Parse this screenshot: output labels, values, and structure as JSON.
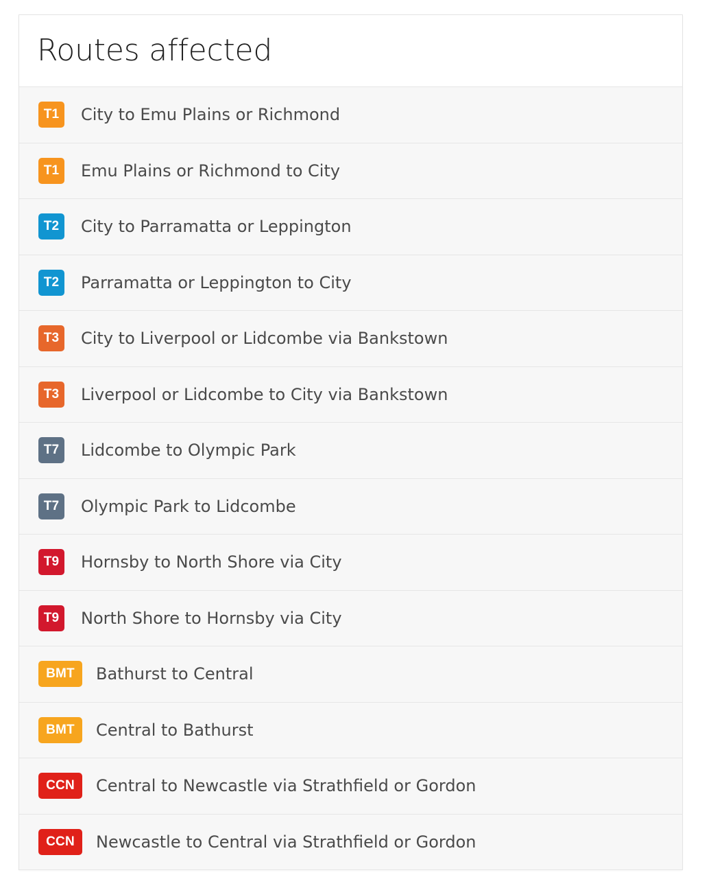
{
  "card": {
    "title": "Routes affected"
  },
  "colors": {
    "page_background": "#ffffff",
    "card_background": "#ffffff",
    "row_background": "#f7f7f7",
    "row_divider": "#e6e6e6",
    "card_border": "#e4e4e4",
    "title_text": "#202020",
    "label_text": "#4a4a4a",
    "badge_T1": "#f7941e",
    "badge_T2": "#1195d1",
    "badge_T3": "#e7672b",
    "badge_T7": "#5e7185",
    "badge_T9": "#d2182d",
    "badge_BMT": "#f7a51e",
    "badge_CCN": "#e02119"
  },
  "routes": [
    {
      "code": "T1",
      "label": "City to Emu Plains or Richmond",
      "color": "#f7941e",
      "wide": false
    },
    {
      "code": "T1",
      "label": "Emu Plains or Richmond to City",
      "color": "#f7941e",
      "wide": false
    },
    {
      "code": "T2",
      "label": "City to Parramatta or Leppington",
      "color": "#1195d1",
      "wide": false
    },
    {
      "code": "T2",
      "label": "Parramatta or Leppington to City",
      "color": "#1195d1",
      "wide": false
    },
    {
      "code": "T3",
      "label": "City to Liverpool or Lidcombe via Bankstown",
      "color": "#e7672b",
      "wide": false
    },
    {
      "code": "T3",
      "label": "Liverpool or Lidcombe to City via Bankstown",
      "color": "#e7672b",
      "wide": false
    },
    {
      "code": "T7",
      "label": "Lidcombe to Olympic Park",
      "color": "#5e7185",
      "wide": false
    },
    {
      "code": "T7",
      "label": "Olympic Park to Lidcombe",
      "color": "#5e7185",
      "wide": false
    },
    {
      "code": "T9",
      "label": "Hornsby to North Shore via City",
      "color": "#d2182d",
      "wide": false
    },
    {
      "code": "T9",
      "label": "North Shore to Hornsby via City",
      "color": "#d2182d",
      "wide": false
    },
    {
      "code": "BMT",
      "label": "Bathurst to Central",
      "color": "#f7a51e",
      "wide": true
    },
    {
      "code": "BMT",
      "label": "Central to Bathurst",
      "color": "#f7a51e",
      "wide": true
    },
    {
      "code": "CCN",
      "label": "Central to Newcastle via Strathfield or Gordon",
      "color": "#e02119",
      "wide": true
    },
    {
      "code": "CCN",
      "label": "Newcastle to Central via Strathfield or Gordon",
      "color": "#e02119",
      "wide": true
    }
  ]
}
